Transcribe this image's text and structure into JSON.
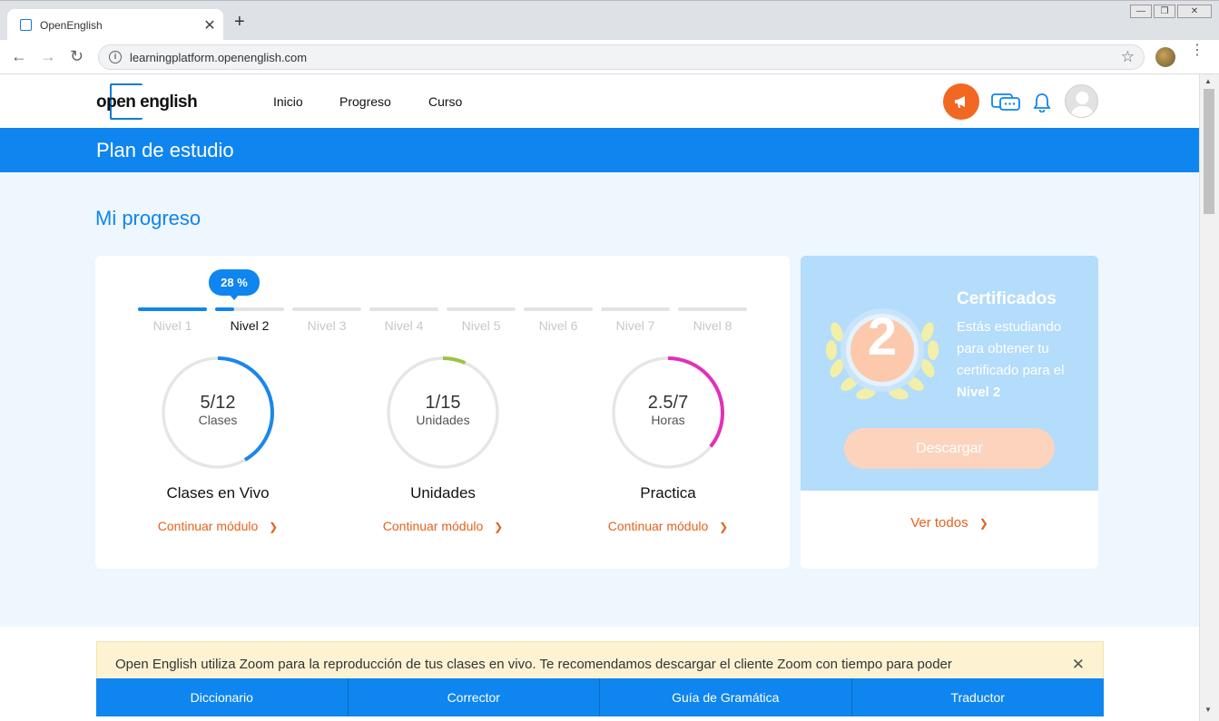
{
  "browser": {
    "tab_title": "OpenEnglish",
    "tab_close": "✕",
    "new_tab": "+",
    "url": "learningplatform.openenglish.com",
    "info_icon": "i",
    "star": "☆",
    "back": "←",
    "forward": "→",
    "reload": "↻",
    "menu": "⋮",
    "window_controls": [
      "—",
      "❐",
      "✕"
    ]
  },
  "header": {
    "logo_text": "open english",
    "nav": [
      "Inicio",
      "Progreso",
      "Curso"
    ],
    "notify_icon": "megaphone-icon",
    "accent_color": "#f26722"
  },
  "banner": {
    "title": "Plan de estudio",
    "color": "#0f85ef"
  },
  "progress": {
    "section_title": "Mi progreso",
    "current_level_percent": "28 %",
    "current_level_fraction": 0.28,
    "levels": [
      "Nivel 1",
      "Nivel 2",
      "Nivel 3",
      "Nivel 4",
      "Nivel 5",
      "Nivel 6",
      "Nivel 7",
      "Nivel 8"
    ],
    "active_level_index": 1,
    "modules": [
      {
        "value": "5/12",
        "unit": "Clases",
        "title": "Clases en Vivo",
        "link": "Continuar módulo",
        "fraction": 0.4167,
        "color": "#1a87ea"
      },
      {
        "value": "1/15",
        "unit": "Unidades",
        "title": "Unidades",
        "link": "Continuar módulo",
        "fraction": 0.0667,
        "color": "#9cc340"
      },
      {
        "value": "2.5/7",
        "unit": "Horas",
        "title": "Practica",
        "link": "Continuar módulo",
        "fraction": 0.357,
        "color": "#e230b8"
      }
    ]
  },
  "certificate": {
    "medal_number": "2",
    "title": "Certificados",
    "desc_prefix": "Estás estudiando para obtener tu certificado para el ",
    "desc_level": "Nivel 2",
    "download": "Descargar",
    "see_all": "Ver todos"
  },
  "zoom_notice": {
    "text": "Open English utiliza Zoom para la reproducción de tus clases en vivo. Te recomendamos descargar el cliente Zoom con tiempo para poder",
    "close": "✕"
  },
  "tools": [
    "Diccionario",
    "Corrector",
    "Guía de Gramática",
    "Traductor"
  ]
}
